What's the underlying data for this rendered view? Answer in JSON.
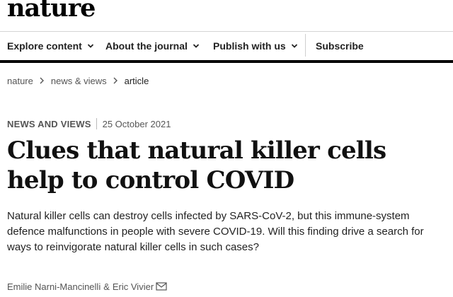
{
  "brand": {
    "logo_text": "nature"
  },
  "nav": {
    "items": [
      {
        "label": "Explore content",
        "has_dropdown": true
      },
      {
        "label": "About the journal",
        "has_dropdown": true
      },
      {
        "label": "Publish with us",
        "has_dropdown": true
      },
      {
        "label": "Subscribe",
        "has_dropdown": false
      }
    ]
  },
  "breadcrumb": {
    "items": [
      {
        "label": "nature"
      },
      {
        "label": "news & views"
      },
      {
        "label": "article"
      }
    ]
  },
  "article": {
    "type": "NEWS AND VIEWS",
    "date": "25 October 2021",
    "title": "Clues that natural killer cells help to control COVID",
    "standfirst": "Natural killer cells can destroy cells infected by SARS-CoV-2, but this immune-system defence malfunctions in people with severe COVID-19. Will this finding drive a search for ways to reinvigorate natural killer cells in such cases?",
    "authors": [
      {
        "name": "Emilie Narni-Mancinelli"
      },
      {
        "name": "Eric Vivier",
        "has_email_icon": true
      }
    ],
    "author_separator": "&"
  },
  "colors": {
    "text": "#222222",
    "muted": "#555555",
    "rule": "#000000"
  }
}
